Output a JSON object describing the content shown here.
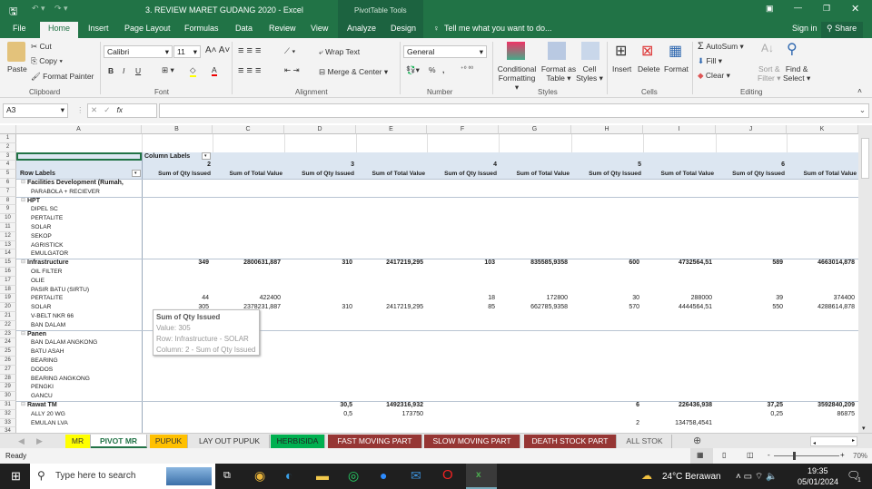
{
  "title": "3. REVIEW MARET GUDANG 2020 - Excel",
  "context_title": "PivotTable Tools",
  "tabs": [
    "File",
    "Home",
    "Insert",
    "Page Layout",
    "Formulas",
    "Data",
    "Review",
    "View",
    "Analyze",
    "Design"
  ],
  "tell_me": "Tell me what you want to do...",
  "sign_in": "Sign in",
  "share": "Share",
  "ribbon": {
    "paste": "Paste",
    "cut": "Cut",
    "copy": "Copy",
    "format_painter": "Format Painter",
    "clipboard": "Clipboard",
    "font_name": "Calibri",
    "font_size": "11",
    "bold": "B",
    "italic": "I",
    "underline": "U",
    "font": "Font",
    "wrap_text": "Wrap Text",
    "merge_center": "Merge & Center",
    "alignment": "Alignment",
    "number_format": "General",
    "percent": "%",
    "comma": ",",
    "number": "Number",
    "conditional": "Conditional",
    "formatting": "Formatting",
    "format_as": "Format as",
    "table": "Table",
    "cell": "Cell",
    "styles_btn": "Styles",
    "styles": "Styles",
    "insert": "Insert",
    "delete": "Delete",
    "format": "Format",
    "cells": "Cells",
    "autosum": "AutoSum",
    "fill": "Fill",
    "clear": "Clear",
    "sort": "Sort &",
    "filter": "Filter",
    "find": "Find &",
    "select": "Select",
    "editing": "Editing"
  },
  "name_box": "A3",
  "columns": [
    "A",
    "B",
    "C",
    "D",
    "E",
    "F",
    "G",
    "H",
    "I",
    "J",
    "K"
  ],
  "pivot": {
    "column_labels": "Column Labels",
    "row_labels": "Row Labels",
    "periods": [
      "2",
      "3",
      "4",
      "5",
      "6"
    ],
    "qty": "Sum of Qty Issued",
    "val": "Sum of Total Value"
  },
  "rows": [
    {
      "n": "6",
      "label": "Facilities Development (Rumah,",
      "group": true,
      "v": []
    },
    {
      "n": "7",
      "label": "PARABOLA + RECIEVER",
      "v": []
    },
    {
      "n": "8",
      "label": "HPT",
      "group": true,
      "v": []
    },
    {
      "n": "9",
      "label": "DIPEL SC",
      "v": []
    },
    {
      "n": "10",
      "label": "PERTALITE",
      "v": []
    },
    {
      "n": "11",
      "label": "SOLAR",
      "v": []
    },
    {
      "n": "12",
      "label": "SEKOP",
      "v": []
    },
    {
      "n": "13",
      "label": "AGRISTICK",
      "v": []
    },
    {
      "n": "14",
      "label": "EMULGATOR",
      "v": []
    },
    {
      "n": "15",
      "label": "Infrastructure",
      "group": true,
      "v": [
        "349",
        "2800631,887",
        "310",
        "2417219,295",
        "103",
        "835585,9358",
        "600",
        "4732564,51",
        "589",
        "4663014,878"
      ]
    },
    {
      "n": "16",
      "label": "OIL FILTER",
      "v": []
    },
    {
      "n": "17",
      "label": "OLIE",
      "v": []
    },
    {
      "n": "18",
      "label": "PASIR BATU (SIRTU)",
      "v": []
    },
    {
      "n": "19",
      "label": "PERTALITE",
      "v": [
        "44",
        "422400",
        "",
        "",
        "18",
        "172800",
        "30",
        "288000",
        "39",
        "374400"
      ]
    },
    {
      "n": "20",
      "label": "SOLAR",
      "v": [
        "305",
        "2378231,887",
        "310",
        "2417219,295",
        "85",
        "662785,9358",
        "570",
        "4444564,51",
        "550",
        "4288614,878"
      ]
    },
    {
      "n": "21",
      "label": "V-BELT NKR 66",
      "v": []
    },
    {
      "n": "22",
      "label": "BAN DALAM",
      "v": []
    },
    {
      "n": "23",
      "label": "Panen",
      "group": true,
      "v": []
    },
    {
      "n": "24",
      "label": "BAN DALAM ANGKONG",
      "v": []
    },
    {
      "n": "25",
      "label": "BATU ASAH",
      "v": []
    },
    {
      "n": "26",
      "label": "BEARING",
      "v": []
    },
    {
      "n": "27",
      "label": "DODOS",
      "v": []
    },
    {
      "n": "28",
      "label": "BEARING ANGKONG",
      "v": []
    },
    {
      "n": "29",
      "label": "PENGKI",
      "v": []
    },
    {
      "n": "30",
      "label": "GANCU",
      "v": []
    },
    {
      "n": "31",
      "label": "Rawat TM",
      "group": true,
      "v": [
        "",
        "",
        "30,5",
        "1492316,932",
        "",
        "",
        "6",
        "226436,938",
        "37,25",
        "3592840,209"
      ]
    },
    {
      "n": "32",
      "label": "ALLY 20 WG",
      "v": [
        "",
        "",
        "0,5",
        "173750",
        "",
        "",
        "",
        "",
        "0,25",
        "86875"
      ]
    },
    {
      "n": "33",
      "label": "EMULAN LVA",
      "v": [
        "",
        "",
        "",
        "",
        "",
        "",
        "2",
        "134758,4541",
        "",
        ""
      ]
    }
  ],
  "tooltip": {
    "title": "Sum of Qty Issued",
    "value": "Value: 305",
    "row": "Row: Infrastructure - SOLAR",
    "column": "Column: 2 - Sum of Qty Issued"
  },
  "sheets": [
    {
      "name": "MR",
      "color": "#ffff00",
      "fg": "#333"
    },
    {
      "name": "PIVOT MR",
      "color": "#ffffff",
      "fg": "#217346"
    },
    {
      "name": "PUPUK",
      "color": "#ffc000",
      "fg": "#333"
    },
    {
      "name": "LAY OUT PUPUK",
      "color": "#e6e6e6",
      "fg": "#333"
    },
    {
      "name": "HERBISIDA",
      "color": "#00b050",
      "fg": "#222"
    },
    {
      "name": "FAST MOVING PART",
      "color": "#963634",
      "fg": "#fff"
    },
    {
      "name": "SLOW MOVING PART",
      "color": "#963634",
      "fg": "#fff"
    },
    {
      "name": "DEATH STOCK PART",
      "color": "#963634",
      "fg": "#fff"
    },
    {
      "name": "ALL STOK",
      "color": "#e6e6e6",
      "fg": "#555"
    }
  ],
  "status": "Ready",
  "zoom": "70%",
  "taskbar": {
    "search": "Type here to search",
    "weather": "24°C  Berawan",
    "time": "19:35",
    "date": "05/01/2024",
    "notif": "1"
  }
}
